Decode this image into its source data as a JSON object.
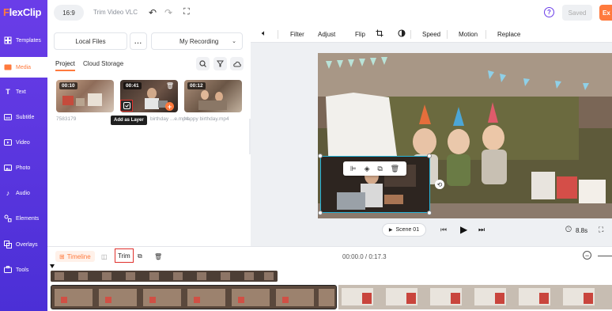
{
  "app": {
    "logo_text": "FlexClip"
  },
  "sidebar": {
    "items": [
      {
        "label": "Templates",
        "icon": "templates-icon"
      },
      {
        "label": "Media",
        "icon": "media-icon",
        "active": true
      },
      {
        "label": "Text",
        "icon": "text-icon"
      },
      {
        "label": "Subtitle",
        "icon": "subtitle-icon"
      },
      {
        "label": "Video",
        "icon": "video-icon"
      },
      {
        "label": "Photo",
        "icon": "photo-icon"
      },
      {
        "label": "Audio",
        "icon": "audio-icon"
      },
      {
        "label": "Elements",
        "icon": "elements-icon"
      },
      {
        "label": "Overlays",
        "icon": "overlays-icon"
      },
      {
        "label": "Tools",
        "icon": "tools-icon"
      }
    ]
  },
  "topbar": {
    "aspect_ratio": "16:9",
    "project_title": "Trim Video VLC",
    "help_label": "?",
    "saved_label": "Saved",
    "export_label": "Ex"
  },
  "media_panel": {
    "local_files": "Local Files",
    "more_label": "...",
    "my_recording": "My Recording",
    "tabs": [
      "Project",
      "Cloud Storage"
    ],
    "items": [
      {
        "duration": "00:10",
        "caption": "7583179"
      },
      {
        "duration": "00:41",
        "caption": "birthday ...e.mp4"
      },
      {
        "duration": "00:12",
        "caption": "happy birthday.mp4"
      }
    ],
    "tooltip": "Add as Layer"
  },
  "editor": {
    "tools": [
      "Filter",
      "Adjust",
      "Flip",
      "Speed",
      "Motion",
      "Replace"
    ],
    "scene_label": "Scene 01",
    "duration": "8.8s"
  },
  "timeline": {
    "timeline_label": "Timeline",
    "trim_label": "Trim",
    "time_readout": "00:00.0 / 0:17.3"
  },
  "colors": {
    "accent": "#ff7a3d",
    "brand": "#5b34e0"
  }
}
